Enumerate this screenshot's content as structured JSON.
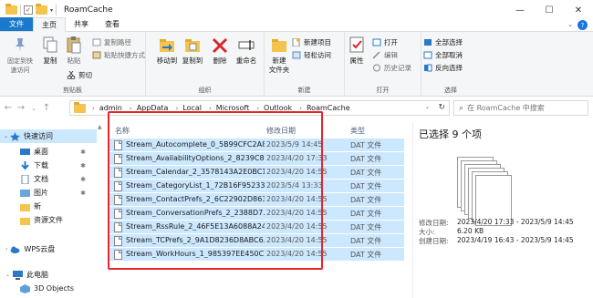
{
  "window": {
    "title": "RoamCache",
    "minimize": "—",
    "maximize": "☐",
    "close": "✕",
    "help": "?"
  },
  "ribbon_tabs": [
    "文件",
    "主页",
    "共享",
    "查看"
  ],
  "ribbon": {
    "clipboard": {
      "pin_quick": "固定到快\n速访问",
      "copy": "复制",
      "paste": "粘贴",
      "copy_path": "复制路径",
      "paste_shortcut": "粘贴快捷方式",
      "cut": "剪切",
      "label": "剪贴板"
    },
    "organize": {
      "move_to": "移动到",
      "copy_to": "复制到",
      "delete": "删除",
      "rename": "重命名",
      "label": "组织"
    },
    "new": {
      "new_folder": "新建\n文件夹",
      "new_item": "新建项目",
      "easy_access": "轻松访问",
      "label": "新建"
    },
    "open": {
      "properties": "属性",
      "open": "打开",
      "edit": "编辑",
      "history": "历史记录",
      "label": "打开"
    },
    "select": {
      "select_all": "全部选择",
      "select_none": "全部取消",
      "invert": "反向选择",
      "label": "选择"
    }
  },
  "address": {
    "crumbs": [
      "admin",
      "AppData",
      "Local",
      "Microsoft",
      "Outlook",
      "RoamCache"
    ],
    "search_placeholder": "在 RoamCache 中搜索"
  },
  "nav": {
    "quick_access": "快速访问",
    "items": [
      {
        "label": "桌面",
        "icon": "desktop-icon",
        "pinned": true
      },
      {
        "label": "下载",
        "icon": "download-icon",
        "pinned": true
      },
      {
        "label": "文档",
        "icon": "documents-icon",
        "pinned": true
      },
      {
        "label": "图片",
        "icon": "pictures-icon",
        "pinned": true
      },
      {
        "label": "新",
        "icon": "folder-icon",
        "pinned": false
      },
      {
        "label": "资源文件",
        "icon": "folder-icon",
        "pinned": false
      }
    ],
    "wps": "WPS云盘",
    "this_pc": "此电脑",
    "objects3d": "3D Objects"
  },
  "list": {
    "col_name": "名称",
    "col_date": "修改日期",
    "col_type": "类型",
    "files": [
      {
        "name": "Stream_Autocomplete_0_5B99CFC2A8...",
        "date": "2023/5/9 14:45",
        "type": "DAT 文件"
      },
      {
        "name": "Stream_AvailabilityOptions_2_8239C8...",
        "date": "2023/4/20 17:33",
        "type": "DAT 文件"
      },
      {
        "name": "Stream_Calendar_2_3578143A2E0BC1...",
        "date": "2023/4/20 14:55",
        "type": "DAT 文件"
      },
      {
        "name": "Stream_CategoryList_1_72B16F95233...",
        "date": "2023/5/4 13:33",
        "type": "DAT 文件"
      },
      {
        "name": "Stream_ContactPrefs_2_6C22902D863...",
        "date": "2023/4/20 14:55",
        "type": "DAT 文件"
      },
      {
        "name": "Stream_ConversationPrefs_2_2388D7...",
        "date": "2023/4/20 14:55",
        "type": "DAT 文件"
      },
      {
        "name": "Stream_RssRule_2_46F5E13A6088A24...",
        "date": "2023/4/20 14:55",
        "type": "DAT 文件"
      },
      {
        "name": "Stream_TCPrefs_2_9A1D8236D8ABC6...",
        "date": "2023/4/20 14:55",
        "type": "DAT 文件"
      },
      {
        "name": "Stream_WorkHours_1_985397EE450C...",
        "date": "2023/4/20 14:55",
        "type": "DAT 文件"
      }
    ]
  },
  "details": {
    "selected": "已选择 9 个项",
    "modified_label": "修改日期:",
    "modified_value": "2023/4/20 17:33 - 2023/5/9 14:45",
    "size_label": "大小:",
    "size_value": "6.20 KB",
    "created_label": "创建日期:",
    "created_value": "2023/4/19 16:43 - 2023/5/9 14:45"
  }
}
